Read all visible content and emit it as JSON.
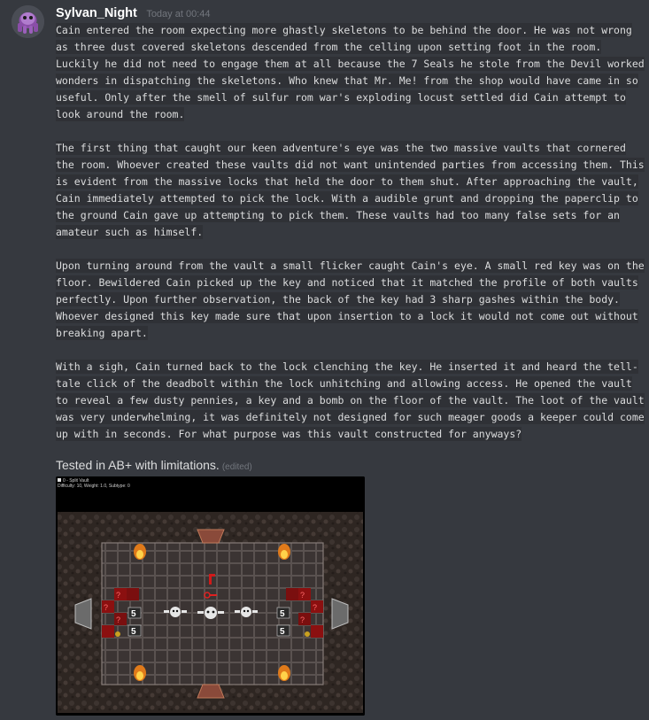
{
  "message": {
    "username": "Sylvan_Night",
    "timestamp": "Today at 00:44",
    "paragraphs": [
      [
        "Cain entered the room expecting more ghastly skeletons to be behind the door. He was not wrong",
        "as three dust covered skeletons descended from the celling upon setting foot in the room.",
        "Luckily he did not need to engage them at all because the 7 Seals he stole from the Devil worked",
        "wonders in dispatching the skeletons. Who knew that Mr. Me! from the shop would have came in so",
        "useful. Only after the smell of sulfur rom war's exploding locust settled did Cain attempt to",
        "look around the room."
      ],
      [
        "The first thing that caught our keen adventure's eye was the two massive vaults that cornered",
        "the room. Whoever created these vaults did not want unintended parties from accessing them. This",
        "is evident from the massive locks that held the door to them shut. After approaching the vault,",
        "Cain immediately attempted to pick the lock. With a audible grunt and dropping the paperclip to",
        "the ground Cain gave up attempting to pick them. These vaults had too many false sets for an",
        "amateur such as himself."
      ],
      [
        "Upon turning around from the vault a small flicker caught Cain's eye. A small red key was on the",
        "floor. Bewildered Cain picked up the key and noticed that it matched the profile of both vaults",
        "perfectly. Upon further observation, the back of the key had 3 sharp gashes within the body.",
        "Whoever designed this key made sure that upon insertion to a lock it would not come out without",
        "breaking apart."
      ],
      [
        "With a sigh, Cain turned back to the lock clenching the key. He inserted it and heard the tell-",
        "tale click of the deadbolt within the lock unhitching and allowing access. He opened the vault",
        "to reveal a few dusty pennies, a key and a bomb on the floor of the vault. The loot of the vault",
        "was very underwhelming, it was definitely not designed for such meager goods a keeper could come",
        "up with in seconds. For what purpose was this vault constructed for anyways?"
      ]
    ],
    "caption": "Tested in AB+ with limitations.",
    "edited_label": "(edited)"
  },
  "attachment": {
    "window_title": "0 - Split Vault",
    "window_subtitle": "Difficulty: 10, Weight: 1.0, Subtype: 0",
    "seal_number": "5"
  },
  "colors": {
    "background": "#36393f",
    "code_background": "#2f3136",
    "username": "#ffffff",
    "timestamp": "#72767d",
    "text": "#dcddde"
  }
}
